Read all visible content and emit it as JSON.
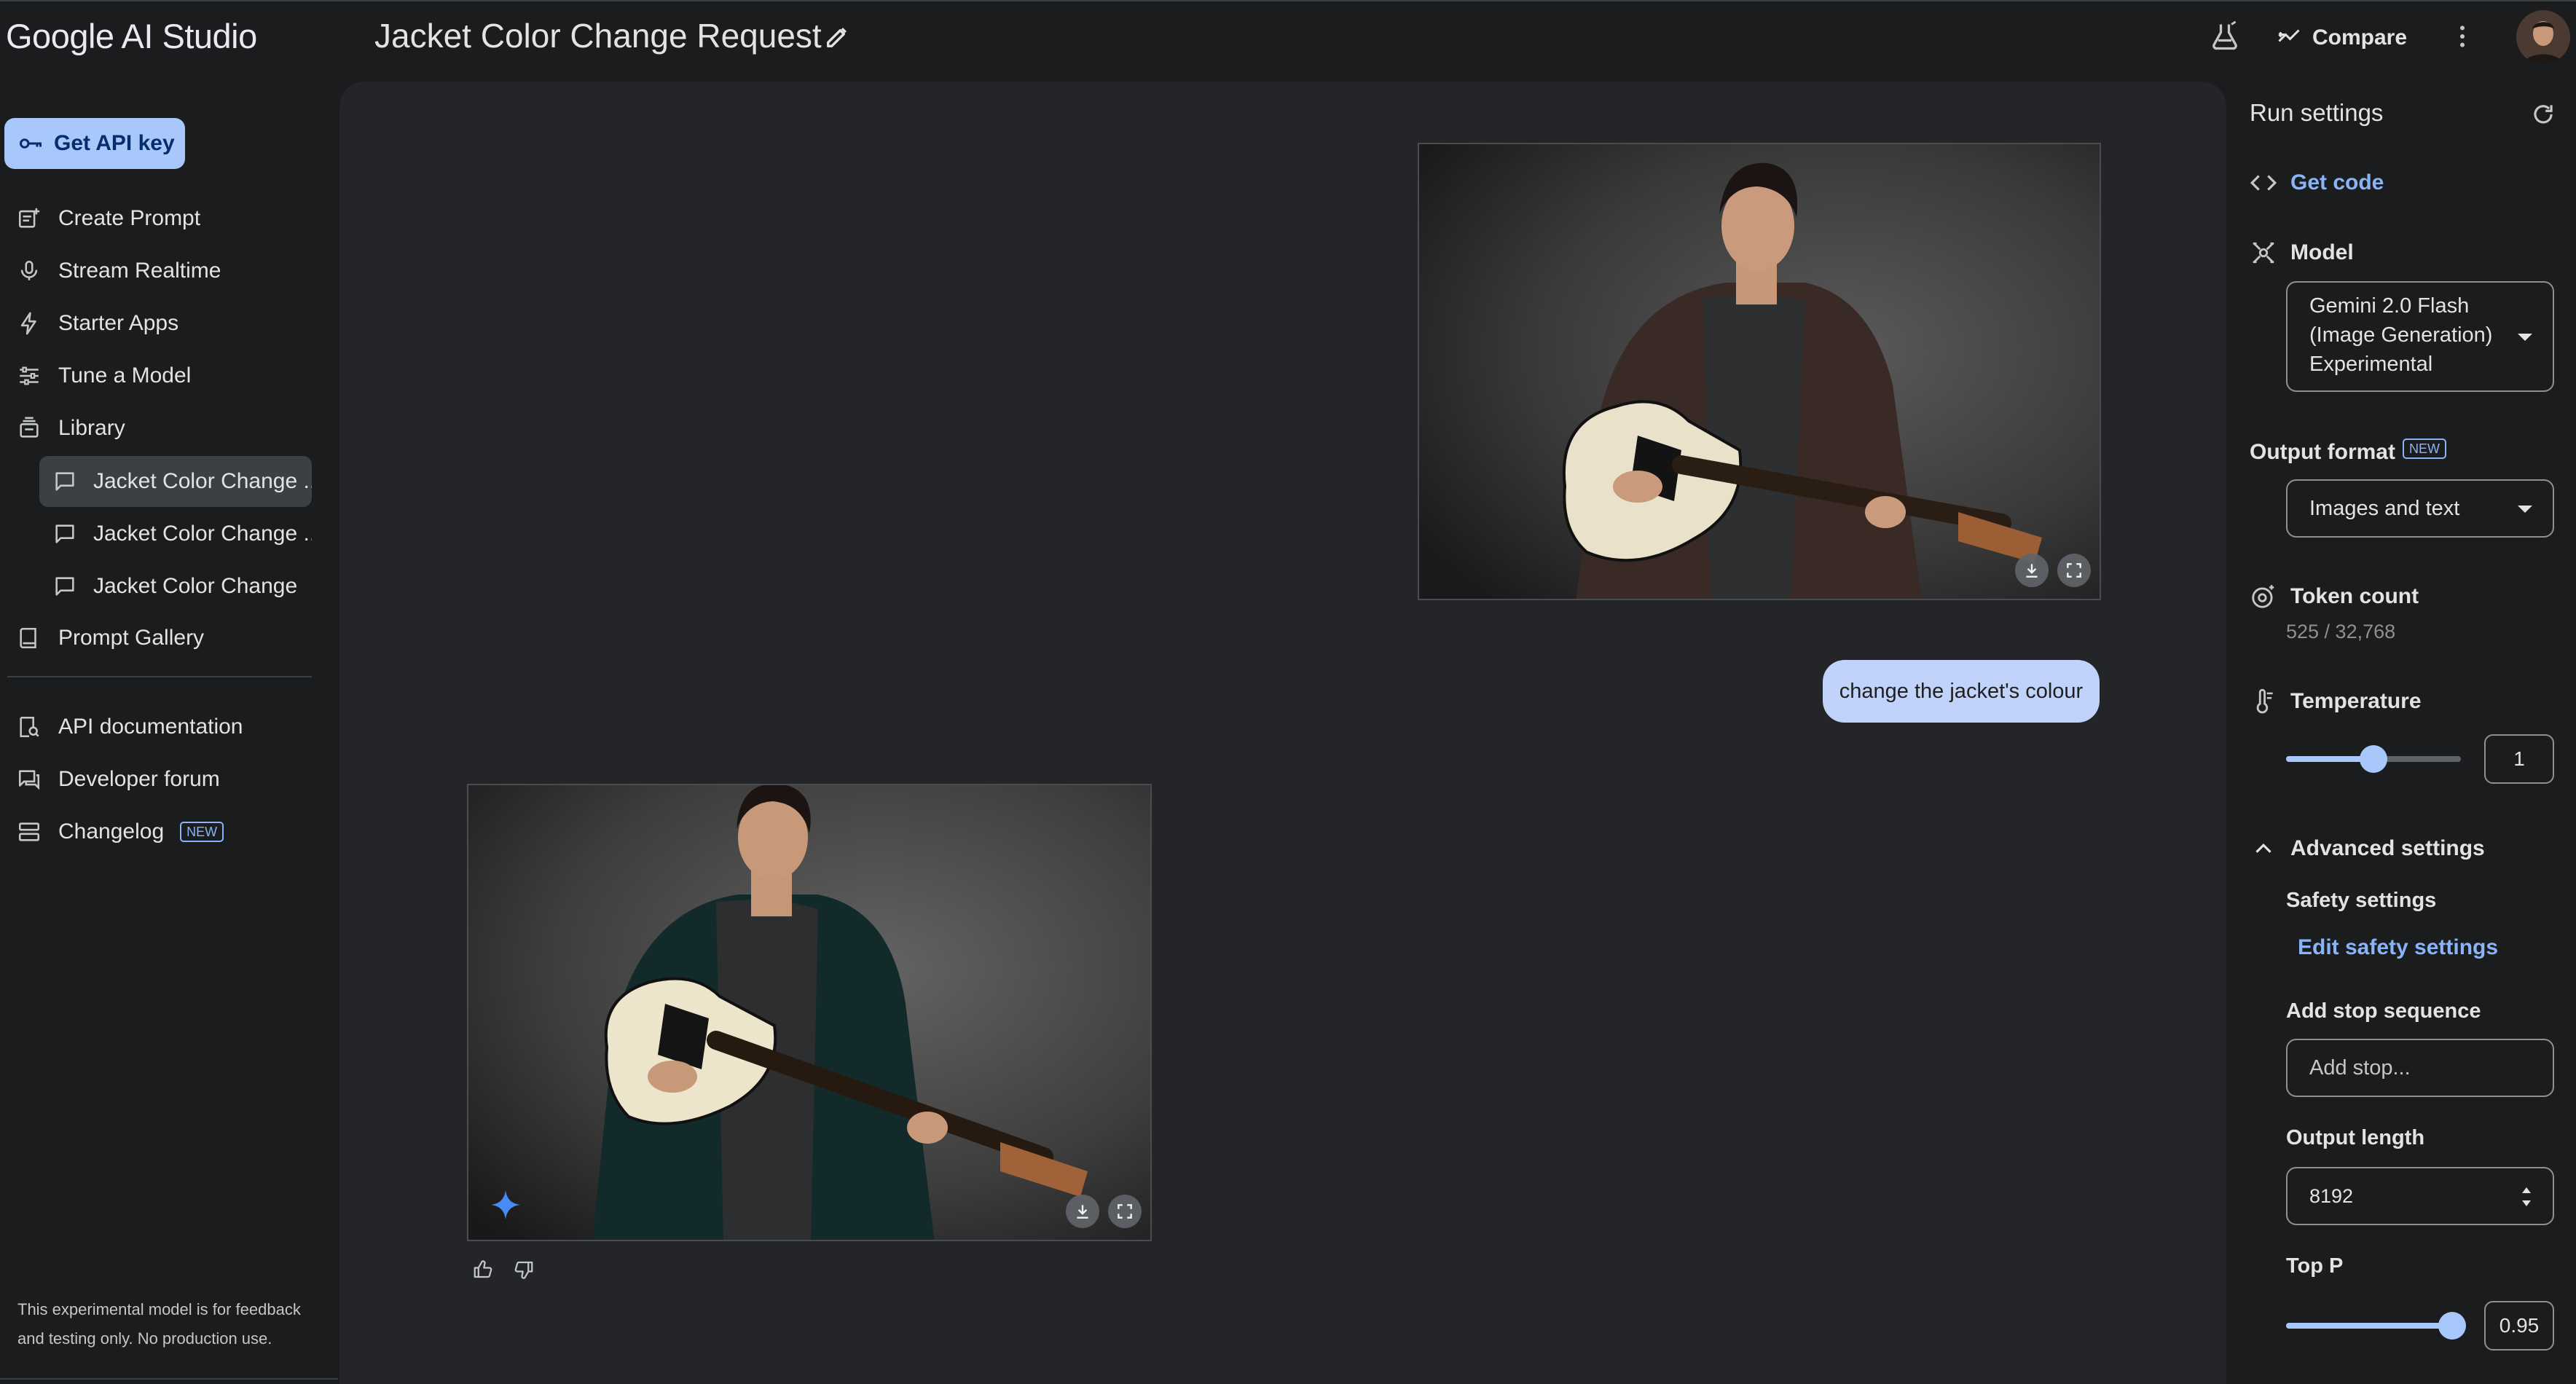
{
  "app": {
    "name": "Google AI Studio"
  },
  "header": {
    "prompt_title": "Jacket Color Change Request",
    "compare_label": "Compare"
  },
  "sidebar": {
    "api_key_label": "Get API key",
    "nav": [
      {
        "label": "Create Prompt",
        "icon": "create-prompt-icon"
      },
      {
        "label": "Stream Realtime",
        "icon": "microphone-icon"
      },
      {
        "label": "Starter Apps",
        "icon": "bolt-icon"
      },
      {
        "label": "Tune a Model",
        "icon": "tune-icon"
      },
      {
        "label": "Library",
        "icon": "library-icon"
      }
    ],
    "library_items": [
      {
        "label": "Jacket Color Change ...",
        "active": true
      },
      {
        "label": "Jacket Color Change ...",
        "active": false
      },
      {
        "label": "Jacket Color Change",
        "active": false
      }
    ],
    "prompt_gallery_label": "Prompt Gallery",
    "footer_nav": [
      {
        "label": "API documentation",
        "icon": "docs-search-icon"
      },
      {
        "label": "Developer forum",
        "icon": "forum-icon"
      },
      {
        "label": "Changelog",
        "icon": "changelog-icon",
        "badge": "NEW"
      }
    ],
    "footnote": "This experimental model is for feedback and testing only. No production use."
  },
  "chat": {
    "user_message": "change the jacket's colour",
    "user_image": {
      "jacket_color": "#3a2a26",
      "description_icon": "photo"
    },
    "model_image": {
      "jacket_color": "#132a2a"
    }
  },
  "run_settings": {
    "title": "Run settings",
    "get_code_label": "Get code",
    "model_label": "Model",
    "model_lines": [
      "Gemini 2.0 Flash",
      "(Image Generation)",
      "Experimental"
    ],
    "output_format_label": "Output format",
    "output_format_badge": "NEW",
    "output_format_value": "Images and text",
    "token_count_label": "Token count",
    "token_count_value": "525 / 32,768",
    "temperature_label": "Temperature",
    "temperature_value": "1",
    "temperature_fraction": 0.5,
    "advanced_label": "Advanced settings",
    "safety_label": "Safety settings",
    "edit_safety_label": "Edit safety settings",
    "stop_sequence_label": "Add stop sequence",
    "stop_sequence_placeholder": "Add stop...",
    "output_length_label": "Output length",
    "output_length_value": "8192",
    "top_p_label": "Top P",
    "top_p_value": "0.95",
    "top_p_fraction": 0.95
  },
  "colors": {
    "background": "#1b1c1d",
    "panel": "#232528",
    "accent": "#a8c7fa",
    "link": "#8ab4f8",
    "user_bubble": "#c2d3fb"
  }
}
